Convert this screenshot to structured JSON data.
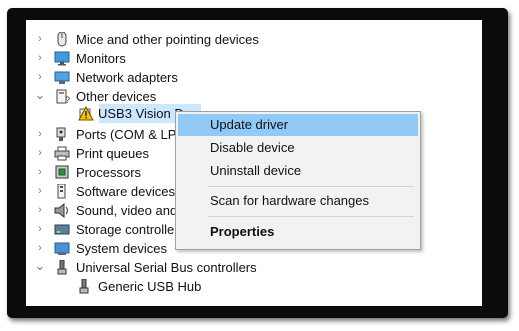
{
  "tree": {
    "items": [
      {
        "label": "Mice and other pointing devices",
        "chevron": "›",
        "icon": "mouse-icon"
      },
      {
        "label": "Monitors",
        "chevron": "›",
        "icon": "monitor-icon"
      },
      {
        "label": "Network adapters",
        "chevron": "›",
        "icon": "network-adapter-icon"
      },
      {
        "label": "Other devices",
        "chevron": "⌄",
        "icon": "other-device-icon"
      },
      {
        "label": "USB3 Vision D",
        "chevron": "",
        "icon": "warning-device-icon"
      },
      {
        "label": "Ports (COM & LP",
        "chevron": "›",
        "icon": "port-icon"
      },
      {
        "label": "Print queues",
        "chevron": "›",
        "icon": "printer-icon"
      },
      {
        "label": "Processors",
        "chevron": "›",
        "icon": "processor-icon"
      },
      {
        "label": "Software devices",
        "chevron": "›",
        "icon": "software-device-icon"
      },
      {
        "label": "Sound, video and",
        "chevron": "›",
        "icon": "speaker-icon"
      },
      {
        "label": "Storage controlle",
        "chevron": "›",
        "icon": "storage-controller-icon"
      },
      {
        "label": "System devices",
        "chevron": "›",
        "icon": "system-device-icon"
      },
      {
        "label": "Universal Serial Bus controllers",
        "chevron": "⌄",
        "icon": "usb-icon"
      },
      {
        "label": "Generic USB Hub",
        "chevron": "",
        "icon": "usb-hub-icon"
      }
    ]
  },
  "context_menu": {
    "update_driver": "Update driver",
    "disable_device": "Disable device",
    "uninstall_device": "Uninstall device",
    "scan": "Scan for hardware changes",
    "properties": "Properties"
  },
  "colors": {
    "selection": "#cce8ff",
    "menu_highlight": "#91c9f7",
    "warning": "#f5c400"
  }
}
